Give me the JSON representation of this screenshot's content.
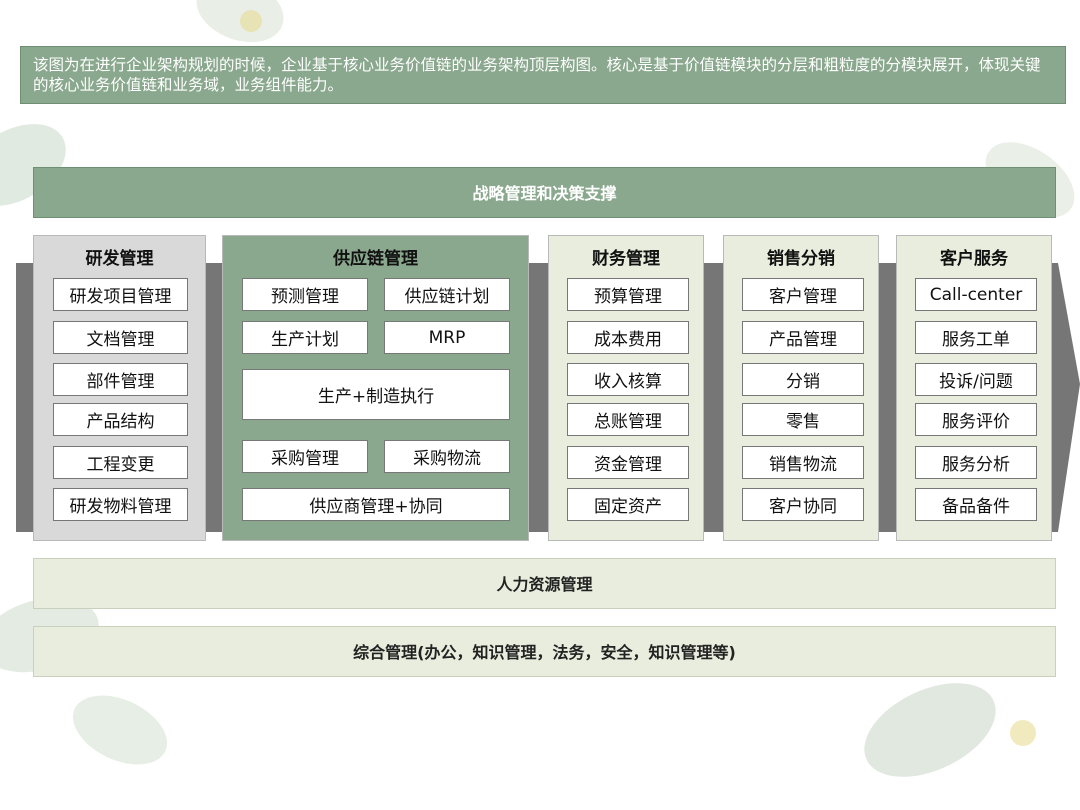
{
  "description": "该图为在进行企业架构规划的时候，企业基于核心业务价值链的业务架构顶层构图。核心是基于价值链模块的分层和粗粒度的分模块展开，体现关键的核心业务价值链和业务域，业务组件能力。",
  "top_band": "战略管理和决策支撑",
  "hr_band": "人力资源管理",
  "general_band": "综合管理(办公，知识管理，法务，安全，知识管理等)",
  "columns": {
    "rd": {
      "title": "研发管理",
      "items": [
        "研发项目管理",
        "文档管理",
        "部件管理",
        "产品结构",
        "工程变更",
        "研发物料管理"
      ]
    },
    "sc": {
      "title": "供应链管理",
      "items": [
        "预测管理",
        "供应链计划",
        "生产计划",
        "MRP",
        "生产+制造执行",
        "采购管理",
        "采购物流",
        "供应商管理+协同"
      ]
    },
    "fi": {
      "title": "财务管理",
      "items": [
        "预算管理",
        "成本费用",
        "收入核算",
        "总账管理",
        "资金管理",
        "固定资产"
      ]
    },
    "sa": {
      "title": "销售分销",
      "items": [
        "客户管理",
        "产品管理",
        "分销",
        "零售",
        "销售物流",
        "客户协同"
      ]
    },
    "cs": {
      "title": "客户服务",
      "items": [
        "Call-center",
        "服务工单",
        "投诉/问题",
        "服务评价",
        "服务分析",
        "备品备件"
      ]
    }
  },
  "colors": {
    "green": "#8aa88e",
    "light": "#e9eddd",
    "gray": "#d9d9d9",
    "arrow": "#767676"
  }
}
